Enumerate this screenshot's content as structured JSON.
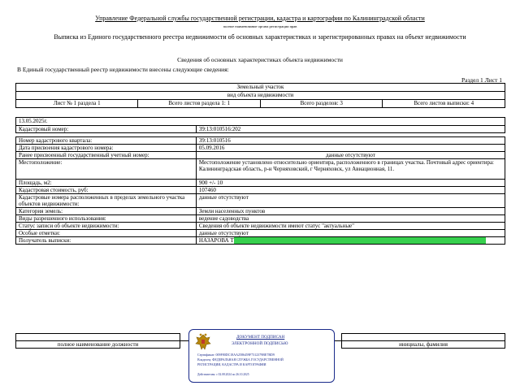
{
  "header": {
    "agency": "Управление Федеральной службы государственной регистрации, кадастра и картографии по Калининградской области",
    "agency_sub": "полное наименование органа регистрации прав",
    "extract_title": "Выписка из Единого государственного реестра недвижимости об основных характеристиках и зарегистрированных правах на объект недвижимости"
  },
  "section_title": "Сведения об основных характеристиках объекта недвижимости",
  "intro": "В Единый государственный реестр недвижимости внесены следующие сведения:",
  "sheet_label": "Раздел 1 Лист 1",
  "object": {
    "type": "Земельный участок",
    "type_caption": "вид объекта недвижимости"
  },
  "counters": {
    "sheet": "Лист № 1 раздела 1",
    "total_sheets_section": "Всего листов раздела 1: 1",
    "total_sections": "Всего разделов: 3",
    "total_sheets": "Всего листов выписки: 4"
  },
  "date": "13.05.2025г.",
  "rows": [
    {
      "label": "Кадастровый номер:",
      "value": "39:13:010516:202"
    },
    {
      "label": "Номер кадастрового квартала:",
      "value": "39:13:010516"
    },
    {
      "label": "Дата присвоения кадастрового номера:",
      "value": "05.09.2016"
    },
    {
      "label": "Ранее присвоенный государственный учетный номер:",
      "value": "данные отсутствуют"
    },
    {
      "label": "Местоположение:",
      "value": "Местоположение установлено относительно ориентира, расположенного в границах участка. Почтовый адрес ориентира: Калининградская область, р-н Черняховский, г Черняховск, ул Авиационная, 11."
    },
    {
      "label": "Площадь, м2:",
      "value": "900 +/- 10"
    },
    {
      "label": "Кадастровая стоимость, руб:",
      "value": "107460"
    },
    {
      "label": "Кадастровые номера расположенных в пределах земельного участка объектов недвижимости:",
      "value": "данные отсутствуют"
    },
    {
      "label": "Категория земель:",
      "value": "Земли населенных пунктов"
    },
    {
      "label": "Виды разрешенного использования:",
      "value": "ведение садоводства"
    },
    {
      "label": "Статус записи об объекте недвижимости:",
      "value": "Сведения об объекте недвижимости имеют статус \"актуальные\""
    },
    {
      "label": "Особые отметки:",
      "value": "данные отсутствуют"
    },
    {
      "label": "Получатель выписки:",
      "value": "НАЗАРОВА Т"
    }
  ],
  "signature": {
    "position": "полное наименование должности",
    "initials": "инициалы, фамилия"
  },
  "stamp": {
    "line1": "ДОКУМЕНТ ПОДПИСАН",
    "line2": "ЭЛЕКТРОННОЙ ПОДПИСЬЮ",
    "line3": "Сертификат: 009F80DC18AA2586459F7312379BE7BD9",
    "line4": "Владелец: ФЕДЕРАЛЬНАЯ СЛУЖБА ГОСУДАРСТВЕННОЙ",
    "line5": "РЕГИСТРАЦИИ, КАДАСТРА И КАРТОГРАФИИ",
    "line6": "",
    "line7": "Действителен: с 02.08.2024 по 26.10.2025",
    "emblem": "russian-eagle-emblem",
    "color": "#1a2a8a"
  },
  "redaction_color": "#37d04e"
}
